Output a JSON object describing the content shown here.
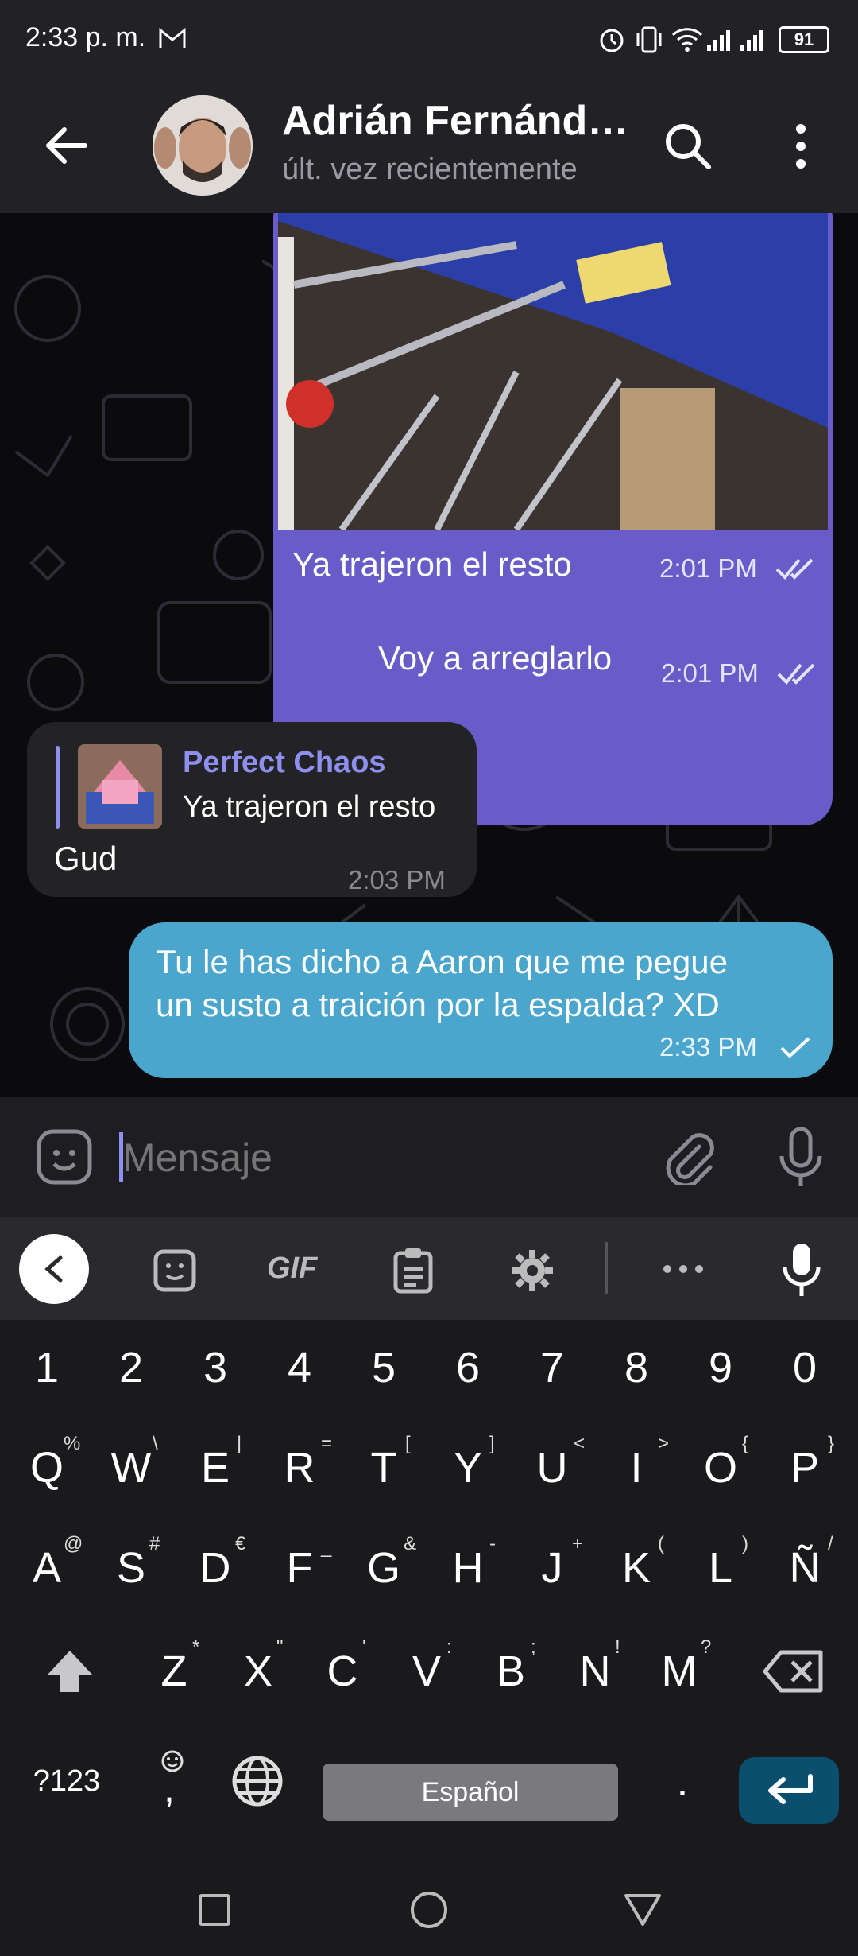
{
  "status_bar": {
    "time": "2:33 p. m.",
    "battery": "91"
  },
  "header": {
    "name": "Adrián Fernánd…",
    "status": "últ. vez recientemente"
  },
  "messages": [
    {
      "text": "Ya trajeron el resto",
      "time": "2:01 PM",
      "status": "read"
    },
    {
      "text": "Voy a arreglarlo",
      "time": "2:01 PM",
      "status": "read"
    },
    {
      "reply_author": "Perfect Chaos",
      "reply_text": "Ya trajeron el resto",
      "text": "Gud",
      "time": "2:03 PM"
    },
    {
      "line1": "Tu le has dicho a Aaron que me pegue",
      "line2": "un susto a traición por la espalda? XD",
      "time": "2:33 PM",
      "status": "sent"
    }
  ],
  "input": {
    "placeholder": "Mensaje"
  },
  "keyboard_toolbar": {
    "gif": "GIF"
  },
  "keyboard": {
    "numbers": [
      "1",
      "2",
      "3",
      "4",
      "5",
      "6",
      "7",
      "8",
      "9",
      "0"
    ],
    "row1": [
      "Q",
      "W",
      "E",
      "R",
      "T",
      "Y",
      "U",
      "I",
      "O",
      "P"
    ],
    "row1_sup": [
      "%",
      "\\",
      "|",
      "=",
      "[",
      "]",
      "<",
      ">",
      "{",
      "}"
    ],
    "row2": [
      "A",
      "S",
      "D",
      "F",
      "G",
      "H",
      "J",
      "K",
      "L",
      "Ñ"
    ],
    "row2_sup": [
      "@",
      "#",
      "€",
      "_",
      "&",
      "-",
      "+",
      "(",
      ")",
      "/"
    ],
    "row3": [
      "Z",
      "X",
      "C",
      "V",
      "B",
      "N",
      "M"
    ],
    "row3_sup": [
      "*",
      "\"",
      "'",
      ":",
      ";",
      "!",
      "?"
    ],
    "symbols": "?123",
    "comma": ",",
    "space": "Español",
    "period": "."
  },
  "colors": {
    "bubble_out": "#6a5cc8",
    "bubble_in": "#232325",
    "bubble_last": "#4aa6cc",
    "accent": "#8f8ff0",
    "enter": "#0b4f6e"
  }
}
